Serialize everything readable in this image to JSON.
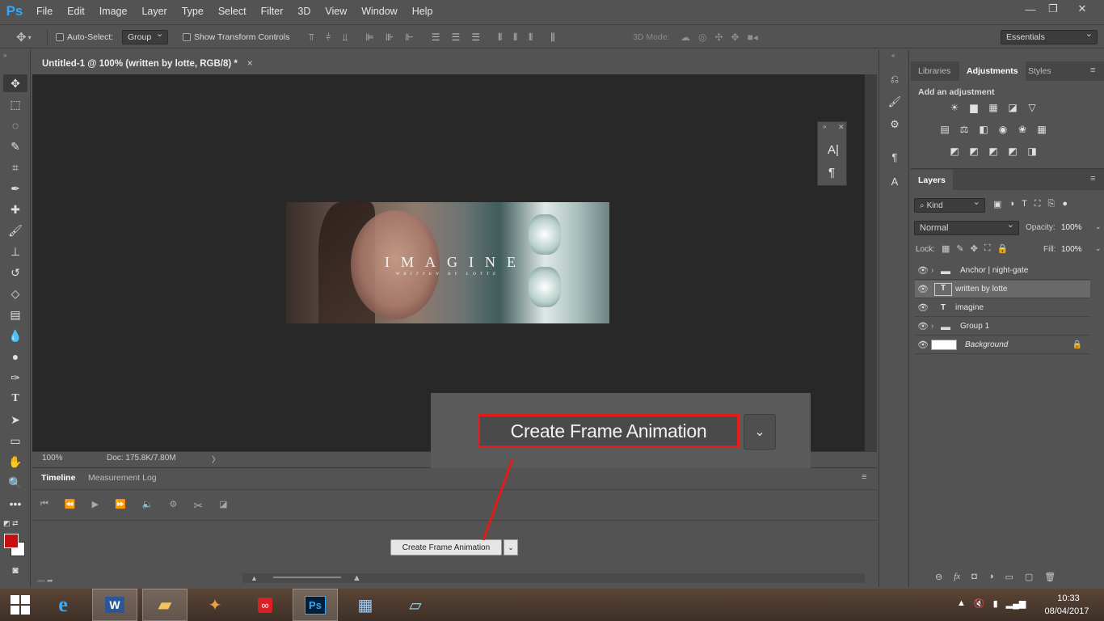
{
  "app": {
    "logo": "Ps",
    "brand_color": "#31a8ff"
  },
  "menu": [
    "File",
    "Edit",
    "Image",
    "Layer",
    "Type",
    "Select",
    "Filter",
    "3D",
    "View",
    "Window",
    "Help"
  ],
  "window_controls": {
    "minimize": "—",
    "restore": "❐",
    "close": "✕"
  },
  "options": {
    "auto_select_label": "Auto-Select:",
    "auto_select_value": "Group",
    "transform_label": "Show Transform Controls",
    "mode_3d_label": "3D Mode:",
    "workspace": "Essentials"
  },
  "document": {
    "tab_title": "Untitled-1 @ 100% (written by lotte, RGB/8) *",
    "tab_close": "×",
    "image_title": "IMAGINE",
    "image_subtitle": "WRITTEN BY LOTTE",
    "zoom": "100%",
    "doc_info": "Doc: 175.8K/7.80M"
  },
  "char_panel": {
    "char_icon": "A|",
    "para_icon": "¶"
  },
  "adjustments": {
    "tabs": [
      "Libraries",
      "Adjustments",
      "Styles"
    ],
    "active_tab": "Adjustments",
    "heading": "Add an adjustment",
    "row1": [
      "☀",
      "▆",
      "▦",
      "◪",
      "▽"
    ],
    "row2": [
      "▤",
      "⚖",
      "◧",
      "◉",
      "❀",
      "▦"
    ],
    "row3": [
      "◩",
      "◩",
      "◩",
      "◩",
      "◨"
    ]
  },
  "layers": {
    "tab": "Layers",
    "filter_kind": "Kind",
    "blend_mode": "Normal",
    "opacity_label": "Opacity:",
    "opacity_value": "100%",
    "lock_label": "Lock:",
    "fill_label": "Fill:",
    "fill_value": "100%",
    "items": [
      {
        "name": "Anchor | night-gate",
        "type": "group"
      },
      {
        "name": "written by lotte",
        "type": "text"
      },
      {
        "name": "imagine",
        "type": "text"
      },
      {
        "name": "Group 1",
        "type": "group"
      },
      {
        "name": "Background",
        "type": "background"
      }
    ],
    "footer_icons": [
      "⊖",
      "fx",
      "◘",
      "◑",
      "▭",
      "▢",
      "🗑"
    ]
  },
  "timeline": {
    "tabs": [
      "Timeline",
      "Measurement Log"
    ],
    "active_tab": "Timeline",
    "create_button": "Create Frame Animation",
    "callout_button": "Create Frame Animation",
    "highlight_color": "#e31b1b"
  },
  "taskbar": {
    "time": "10:33",
    "date": "08/04/2017"
  }
}
